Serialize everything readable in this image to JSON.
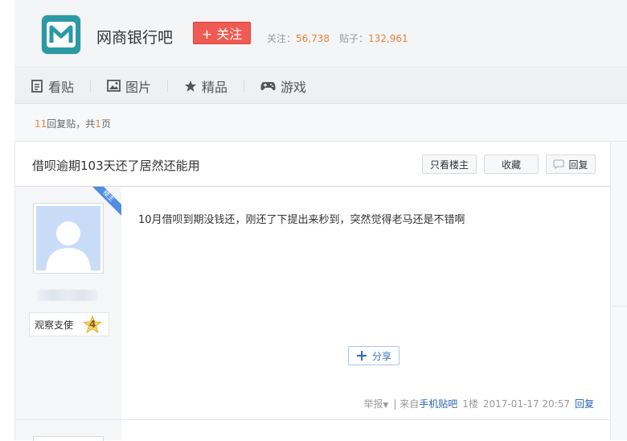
{
  "header": {
    "bar_name": "网商银行吧",
    "follow_label": "+ 关注",
    "follow_prefix": "关注：",
    "follow_count": "56,738",
    "posts_prefix": "贴子：",
    "posts_count": "132,961",
    "logo_icon": "mybank-logo-icon",
    "accent_color": "#ef5b52"
  },
  "nav": {
    "items": [
      {
        "label": "看贴",
        "icon": "document-icon"
      },
      {
        "label": "图片",
        "icon": "image-icon"
      },
      {
        "label": "精品",
        "icon": "star-icon"
      },
      {
        "label": "游戏",
        "icon": "gamepad-icon"
      }
    ]
  },
  "reply_summary": {
    "count": "11",
    "text1": "回复贴，共",
    "pages": "1",
    "text2": "页"
  },
  "post": {
    "title": "借呗逾期103天还了居然还能用",
    "only_op_label": "只看楼主",
    "favorite_label": "收藏",
    "reply_label": "回复",
    "ribbon_label": "楼主",
    "author_title": "观察支使",
    "author_level": "4",
    "content": "10月借呗到期没钱还，刚还了下提出来秒到，突然觉得老马还是不错啊",
    "share_label": "分享",
    "report_label": "举报",
    "source_prefix": "| 来自",
    "source_link": "手机贴吧",
    "floor": "1楼",
    "timestamp": "2017-01-17 20:57",
    "reply_link": "回复"
  }
}
